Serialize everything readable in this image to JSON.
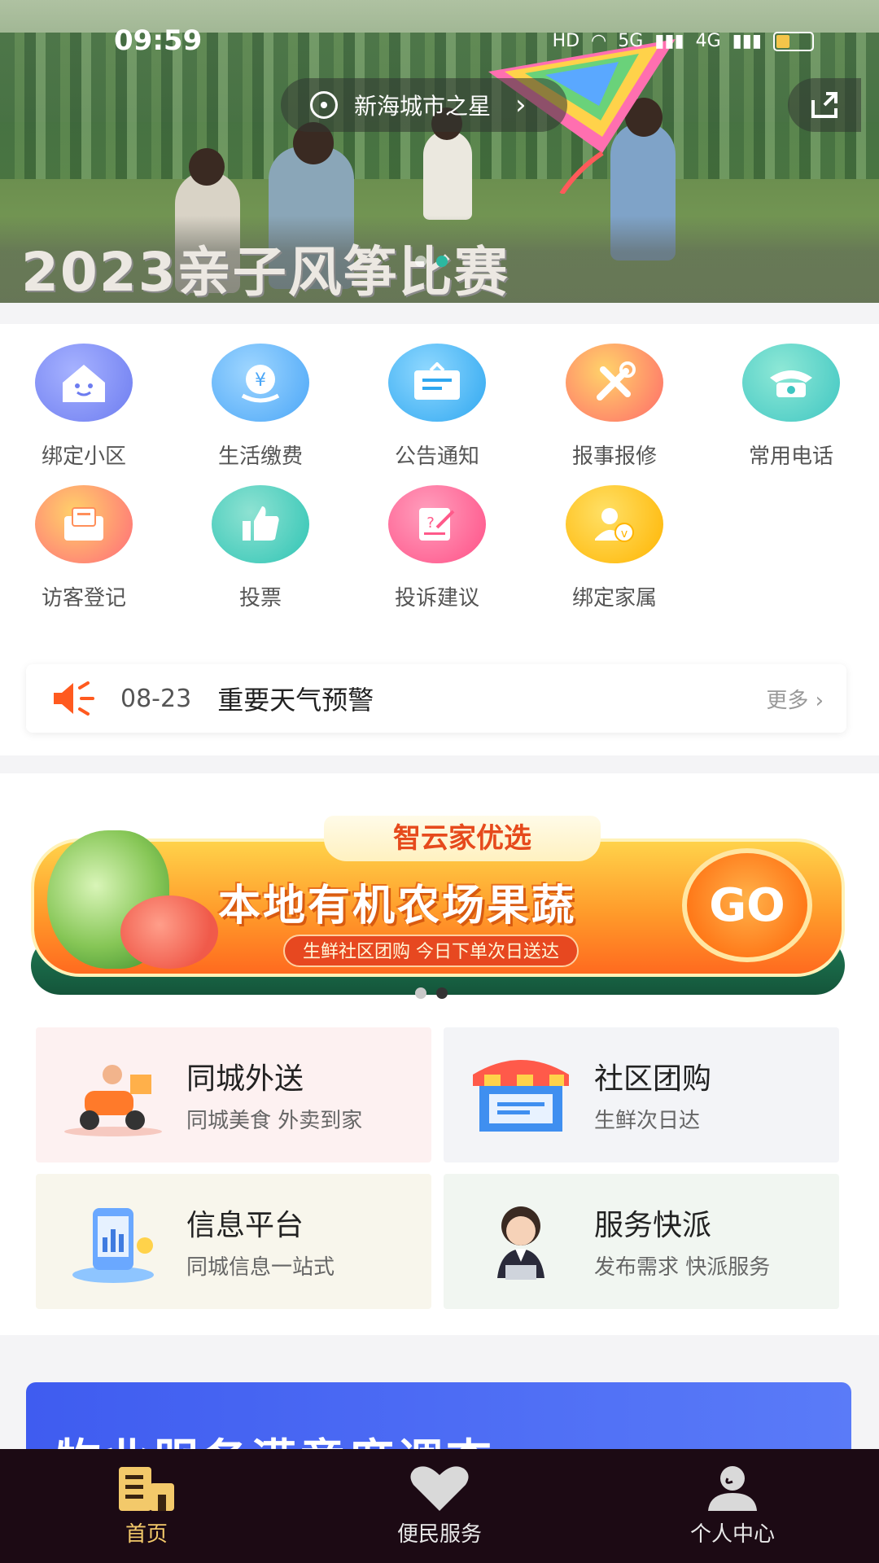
{
  "status": {
    "time": "09:59",
    "net1": "HD",
    "net2": "5G",
    "net3": "4G"
  },
  "header": {
    "location": "新海城市之星"
  },
  "hero": {
    "title": "2023亲子风筝比赛"
  },
  "quick_menu": [
    {
      "label": "绑定小区",
      "icon": "house-icon",
      "color": "#6d7cf0"
    },
    {
      "label": "生活缴费",
      "icon": "payment-icon",
      "color": "#4aa6f7"
    },
    {
      "label": "公告通知",
      "icon": "notice-board-icon",
      "color": "#2fa7f0"
    },
    {
      "label": "报事报修",
      "icon": "repair-tools-icon",
      "color": "#ff8a4a"
    },
    {
      "label": "常用电话",
      "icon": "telephone-icon",
      "color": "#3fc6c2"
    },
    {
      "label": "访客登记",
      "icon": "visitor-mail-icon",
      "color": "#ff8f5a"
    },
    {
      "label": "投票",
      "icon": "thumbs-up-icon",
      "color": "#2ec4b4"
    },
    {
      "label": "投诉建议",
      "icon": "complaint-edit-icon",
      "color": "#ff5a8a"
    },
    {
      "label": "绑定家属",
      "icon": "family-bind-icon",
      "color": "#ffb400"
    }
  ],
  "notice": {
    "date": "08-23",
    "title": "重要天气预警",
    "more": "更多"
  },
  "promo": {
    "tag": "智云家优选",
    "headline": "本地有机农场果蔬",
    "sub": "生鲜社区团购 今日下单次日送达",
    "go": "GO"
  },
  "services": [
    {
      "title": "同城外送",
      "subtitle": "同城美食 外卖到家",
      "icon": "delivery-scooter-icon",
      "bg": "#fdf1f1"
    },
    {
      "title": "社区团购",
      "subtitle": "生鲜次日达",
      "icon": "storefront-icon",
      "bg": "#f3f4f7"
    },
    {
      "title": "信息平台",
      "subtitle": "同城信息一站式",
      "icon": "info-phone-icon",
      "bg": "#f8f6ec"
    },
    {
      "title": "服务快派",
      "subtitle": "发布需求 快派服务",
      "icon": "service-agent-icon",
      "bg": "#f1f6f1"
    }
  ],
  "survey": {
    "title": "物业服务满意度调查"
  },
  "tabbar": [
    {
      "label": "首页",
      "icon": "home-building-icon",
      "active": true
    },
    {
      "label": "便民服务",
      "icon": "heart-icon",
      "active": false
    },
    {
      "label": "个人中心",
      "icon": "person-icon",
      "active": false
    }
  ]
}
